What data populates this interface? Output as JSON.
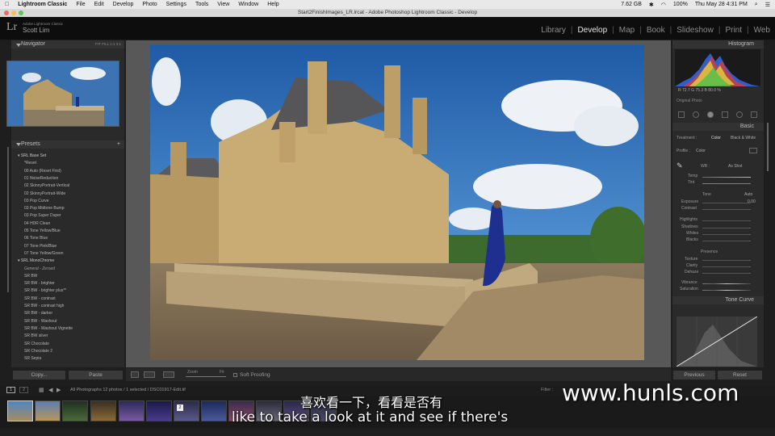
{
  "menubar": {
    "apple": "",
    "app_name": "Lightroom Classic",
    "items": [
      "File",
      "Edit",
      "Develop",
      "Photo",
      "Settings",
      "Tools",
      "View",
      "Window",
      "Help"
    ],
    "status": {
      "storage": "7.62 GB",
      "battery": "100%",
      "datetime": "Thu May 28  4:31 PM"
    }
  },
  "window": {
    "title": "Start2FinishImages_LR.lrcat - Adobe Photoshop Lightroom Classic - Develop"
  },
  "identity": {
    "logo": "Lr",
    "subtitle": "Adobe Lightroom Classic",
    "name": "Scott Lim"
  },
  "modules": {
    "items": [
      {
        "label": "Library",
        "active": false
      },
      {
        "label": "Develop",
        "active": true
      },
      {
        "label": "Map",
        "active": false
      },
      {
        "label": "Book",
        "active": false
      },
      {
        "label": "Slideshow",
        "active": false
      },
      {
        "label": "Print",
        "active": false
      },
      {
        "label": "Web",
        "active": false
      }
    ]
  },
  "left": {
    "navigator_title": "Navigator",
    "navigator_zoom": [
      "FIT",
      "FILL",
      "1:1",
      "3:1"
    ],
    "presets_title": "Presets",
    "presets": [
      {
        "label": "SRL Base Set",
        "type": "folder"
      },
      {
        "label": "*Reset",
        "type": "item"
      },
      {
        "label": "00 Auto (Reset First)",
        "type": "item"
      },
      {
        "label": "01 NoiseReduction",
        "type": "item"
      },
      {
        "label": "02 SkinnyPortrait-Vertical",
        "type": "item"
      },
      {
        "label": "02 SkinnyPortrait-Wide",
        "type": "item"
      },
      {
        "label": "03 Pop Curve",
        "type": "item"
      },
      {
        "label": "03 Pop Midtone Bump",
        "type": "item"
      },
      {
        "label": "03 Pop Super Duper",
        "type": "item"
      },
      {
        "label": "04 HDR Clean",
        "type": "item"
      },
      {
        "label": "05 Tone Yellow/Blue",
        "type": "item"
      },
      {
        "label": "06 Tone Blue",
        "type": "item"
      },
      {
        "label": "07 Tone Pink/Blue",
        "type": "item"
      },
      {
        "label": "07 Tone Yellow/Green",
        "type": "item"
      },
      {
        "label": "SRL MonoChrome",
        "type": "folder"
      },
      {
        "label": "General - Zeroed",
        "type": "italic"
      },
      {
        "label": "SR BW",
        "type": "item"
      },
      {
        "label": "SR BW - brighter",
        "type": "item"
      },
      {
        "label": "SR BW - brighter plus**",
        "type": "item"
      },
      {
        "label": "SR BW - contrast",
        "type": "item"
      },
      {
        "label": "SR BW - contrast high",
        "type": "item"
      },
      {
        "label": "SR BW - darker",
        "type": "item"
      },
      {
        "label": "SR BW - Washout",
        "type": "item"
      },
      {
        "label": "SR BW - Washout Vignette",
        "type": "item"
      },
      {
        "label": "SR BW silver",
        "type": "item"
      },
      {
        "label": "SR Chocolate",
        "type": "item"
      },
      {
        "label": "SR Chocolate 2",
        "type": "item"
      },
      {
        "label": "SR Sepia",
        "type": "item"
      }
    ],
    "copy_label": "Copy...",
    "paste_label": "Paste"
  },
  "toolbar": {
    "zoom_label": "Zoom",
    "fit_label": "Fit",
    "soft_proofing_label": "Soft Proofing"
  },
  "right": {
    "histogram_title": "Histogram",
    "histogram_values": "R  72.7  G  75.3  B  80.0 %",
    "original_photo_label": "Original Photo",
    "basic_title": "Basic",
    "treatment_label": "Treatment :",
    "treatment_color": "Color",
    "treatment_bw": "Black & White",
    "profile_label": "Profile :",
    "profile_value": "Color",
    "wb_label": "WB :",
    "wb_value": "As Shot",
    "temp_label": "Temp",
    "tint_label": "Tint",
    "tone_label": "Tone",
    "auto_label": "Auto",
    "exposure_label": "Exposure",
    "exposure_value": "0.00",
    "contrast_label": "Contrast",
    "highlights_label": "Highlights",
    "shadows_label": "Shadows",
    "whites_label": "Whites",
    "blacks_label": "Blacks",
    "presence_label": "Presence",
    "texture_label": "Texture",
    "clarity_label": "Clarity",
    "dehaze_label": "Dehaze",
    "vibrance_label": "Vibrance",
    "saturation_label": "Saturation",
    "zero": "0",
    "tonecurve_title": "Tone Curve",
    "previous_label": "Previous",
    "reset_label": "Reset"
  },
  "filmstrip": {
    "view1": "1",
    "view2": "2",
    "path": "All Photographs     12 photos / 1 selected  / DSC01917-Edit.tif",
    "filter_label": "Filter :",
    "badge": "2"
  },
  "subtitles": {
    "zh": "喜欢看一下，看看是否有",
    "en": "like to take a look at it and see if there's"
  },
  "watermark": "www.hunls.com"
}
